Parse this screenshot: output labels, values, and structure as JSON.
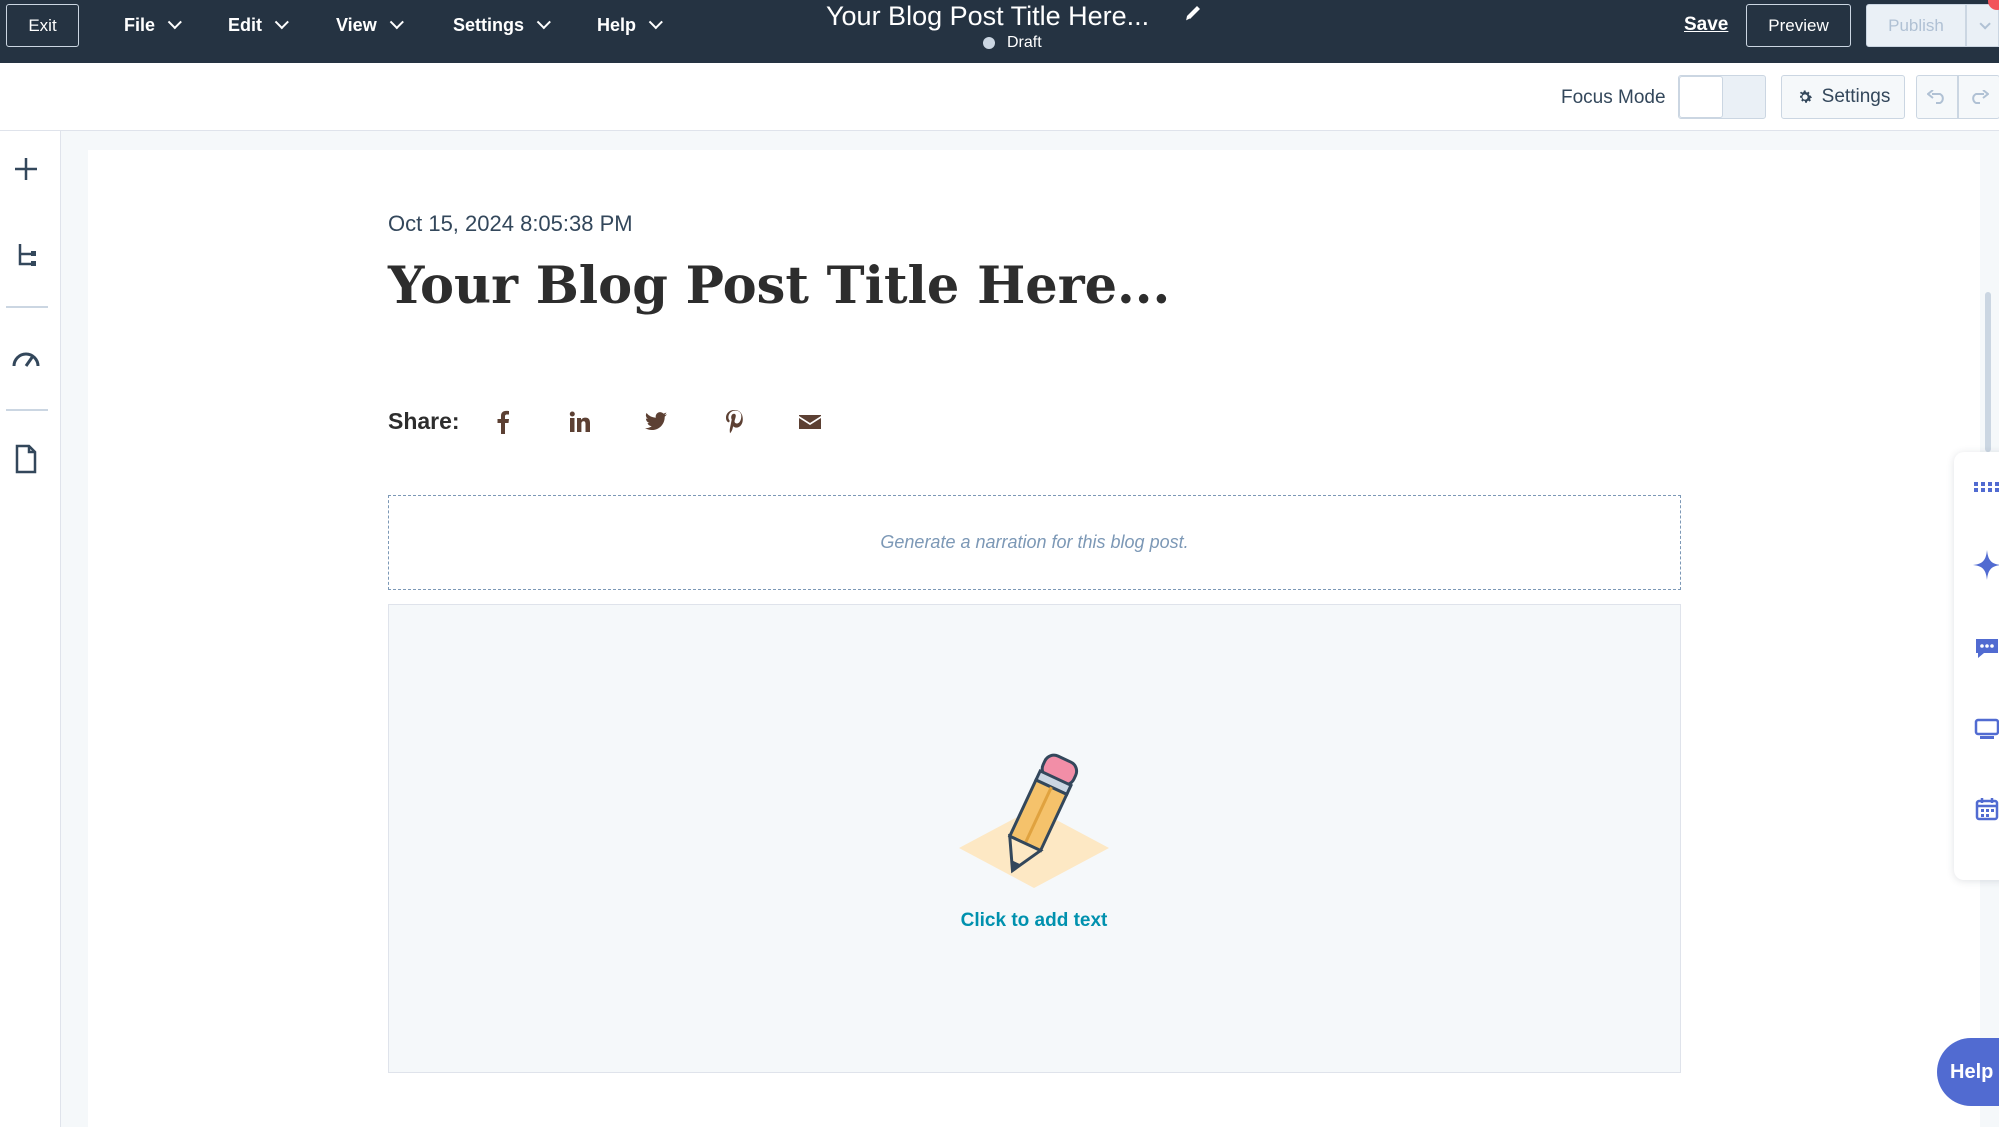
{
  "topbar": {
    "exit_label": "Exit",
    "menus": [
      {
        "label": "File"
      },
      {
        "label": "Edit"
      },
      {
        "label": "View"
      },
      {
        "label": "Settings"
      },
      {
        "label": "Help"
      }
    ],
    "doc_title": "Your Blog Post Title Here...",
    "status": "Draft",
    "save_label": "Save",
    "preview_label": "Preview",
    "publish_label": "Publish"
  },
  "toolbar": {
    "focus_mode_label": "Focus Mode",
    "settings_label": "Settings"
  },
  "post": {
    "date": "Oct 15, 2024 8:05:38 PM",
    "title": "Your Blog Post Title Here...",
    "share_label": "Share:",
    "share_icons": [
      "facebook-icon",
      "linkedin-icon",
      "twitter-icon",
      "pinterest-icon",
      "email-icon"
    ],
    "narration_text": "Generate a narration for this blog post.",
    "add_text_label": "Click to add text"
  },
  "help_label": "Help",
  "colors": {
    "topbar_bg": "#253342",
    "accent_link": "#0091ae",
    "share_icon": "#5c4033",
    "help_bg": "#516bd1"
  }
}
